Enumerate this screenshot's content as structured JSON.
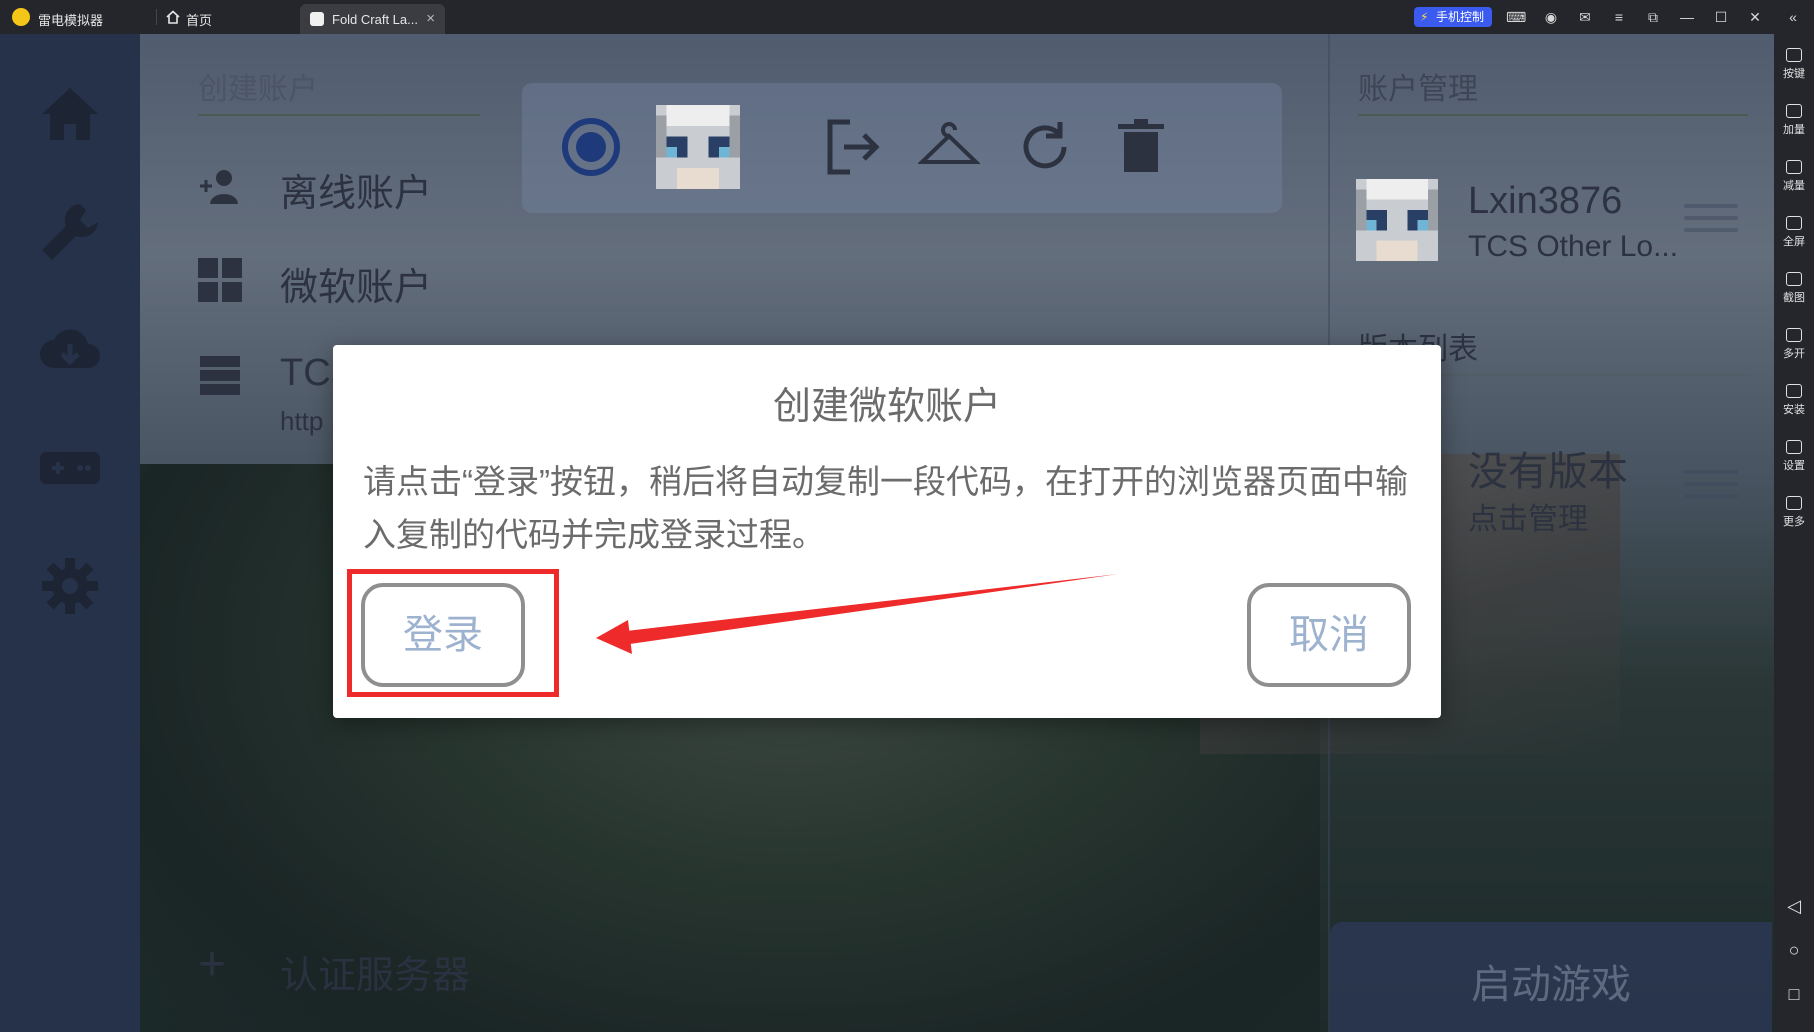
{
  "titlebar": {
    "app_name": "雷电模拟器",
    "home_tab": "首页",
    "app_tab": "Fold Craft La...",
    "close_glyph": "×",
    "phone_control": "手机控制"
  },
  "emulator_sidebar": {
    "tools": [
      "按键",
      "加量",
      "减量",
      "全屏",
      "截图",
      "多开",
      "安装",
      "设置",
      "更多"
    ]
  },
  "launcher": {
    "create_account_header": "创建账户",
    "offline_account": "离线账户",
    "microsoft_account": "微软账户",
    "tcs_label": "TCS",
    "tcs_sub": "http",
    "auth_server": "认证服务器",
    "account_manage_header": "账户管理",
    "username": "Lxin3876",
    "auth_type": "TCS Other Lo...",
    "version_list_header": "版本列表",
    "no_version": "没有版本",
    "click_manage": "点击管理",
    "launch_game": "启动游戏"
  },
  "dialog": {
    "title": "创建微软账户",
    "message": "请点击“登录”按钮，稍后将自动复制一段代码，在打开的浏览器页面中输入复制的代码并完成登录过程。",
    "login_label": "登录",
    "cancel_label": "取消"
  },
  "colors": {
    "annotation_red": "#ee2a2a",
    "dialog_button_text": "#9db2cf",
    "nav_background": "#26324a"
  }
}
